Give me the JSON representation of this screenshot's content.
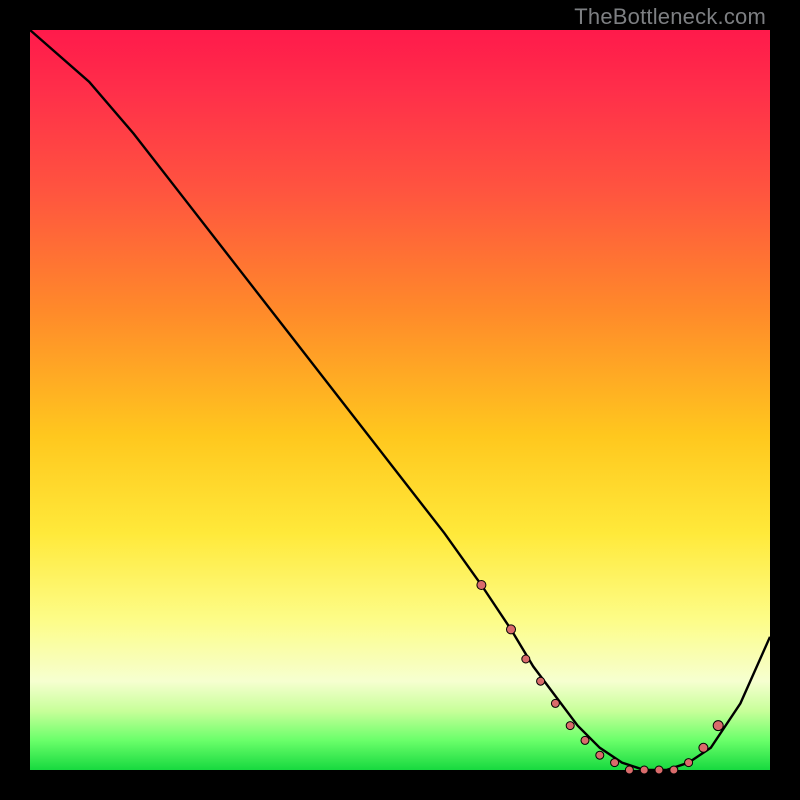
{
  "watermark": "TheBottleneck.com",
  "colors": {
    "curve": "#000000",
    "marker": "#d96b6b",
    "marker_stroke": "#000000"
  },
  "chart_data": {
    "type": "line",
    "title": "",
    "xlabel": "",
    "ylabel": "",
    "xlim": [
      0,
      100
    ],
    "ylim": [
      0,
      100
    ],
    "grid": false,
    "legend": null,
    "series": [
      {
        "name": "curve",
        "x": [
          0,
          8,
          14,
          21,
          28,
          35,
          42,
          49,
          56,
          61,
          65,
          68,
          71,
          74,
          77,
          80,
          83,
          86,
          89,
          92,
          96,
          100
        ],
        "y": [
          100,
          93,
          86,
          77,
          68,
          59,
          50,
          41,
          32,
          25,
          19,
          14,
          10,
          6,
          3,
          1,
          0,
          0,
          1,
          3,
          9,
          18
        ]
      }
    ],
    "markers": {
      "x": [
        61,
        65,
        67,
        69,
        71,
        73,
        75,
        77,
        79,
        81,
        83,
        85,
        87,
        89,
        91,
        93
      ],
      "y": [
        25,
        19,
        15,
        12,
        9,
        6,
        4,
        2,
        1,
        0,
        0,
        0,
        0,
        1,
        3,
        6
      ],
      "r": [
        4.5,
        4.5,
        4,
        4,
        4,
        4,
        4,
        4,
        4,
        4,
        4,
        4,
        4,
        4,
        4.5,
        5
      ]
    }
  }
}
